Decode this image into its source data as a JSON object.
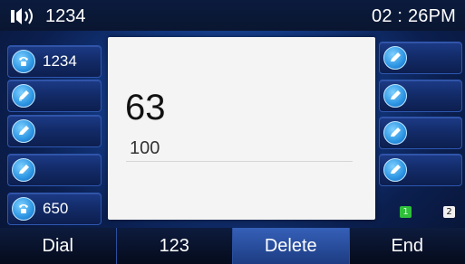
{
  "status": {
    "account": "1234",
    "time": "02 : 26PM",
    "speaker_icon": "speaker-icon"
  },
  "left_keys": [
    {
      "label": "1234",
      "icon": "phone-icon"
    },
    {
      "label": "",
      "icon": "pencil-icon"
    },
    {
      "label": "",
      "icon": "pencil-icon"
    },
    {
      "label": "",
      "icon": "pencil-icon"
    },
    {
      "label": "650",
      "icon": "phone-icon"
    }
  ],
  "right_keys": [
    {
      "label": "",
      "icon": "pencil-icon"
    },
    {
      "label": "",
      "icon": "pencil-icon"
    },
    {
      "label": "",
      "icon": "pencil-icon"
    },
    {
      "label": "",
      "icon": "pencil-icon"
    }
  ],
  "pages": {
    "page1": "1",
    "page2": "2",
    "active_color": "#2fbf3a"
  },
  "dialog": {
    "dialed": "63",
    "subtext": "100"
  },
  "softkeys": {
    "dial": "Dial",
    "input_mode": "123",
    "delete": "Delete",
    "end": "End"
  }
}
